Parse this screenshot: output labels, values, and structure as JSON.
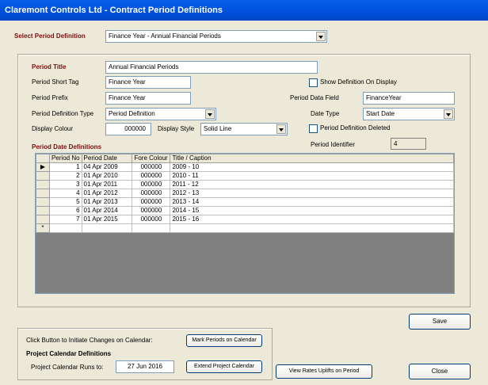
{
  "window": {
    "title": "Claremont Controls Ltd - Contract Period Definitions"
  },
  "select_period": {
    "label": "Select Period Definition",
    "value": "Finance Year - Annual Financial Periods"
  },
  "form": {
    "period_title_label": "Period Title",
    "period_title": "Annual Financial Periods",
    "short_tag_label": "Period Short Tag",
    "short_tag": "Finance Year",
    "prefix_label": "Period Prefix",
    "prefix": "Finance Year",
    "def_type_label": "Period Definition Type",
    "def_type": "Period Definition",
    "colour_label": "Display Colour",
    "colour": "000000",
    "style_label": "Display Style",
    "style": "Solid Line",
    "show_def_label": "Show Definition On Display",
    "data_field_label": "Period Data Field",
    "data_field": "FinanceYear",
    "date_type_label": "Date Type",
    "date_type": "Start Date",
    "deleted_label": "Period Definition Deleted",
    "identifier_label": "Period Identifier",
    "identifier": "4",
    "dates_heading": "Period Date Definitions"
  },
  "grid": {
    "columns": [
      "Period No",
      "Period Date",
      "Fore Colour",
      "Title / Caption"
    ],
    "rows": [
      {
        "no": "1",
        "date": "04 Apr 2009",
        "colour": "000000",
        "title": "2009 - 10"
      },
      {
        "no": "2",
        "date": "01 Apr 2010",
        "colour": "000000",
        "title": "2010 - 11"
      },
      {
        "no": "3",
        "date": "01 Apr 2011",
        "colour": "000000",
        "title": "2011 - 12"
      },
      {
        "no": "4",
        "date": "01 Apr 2012",
        "colour": "000000",
        "title": "2012 - 13"
      },
      {
        "no": "5",
        "date": "01 Apr 2013",
        "colour": "000000",
        "title": "2013 - 14"
      },
      {
        "no": "6",
        "date": "01 Apr 2014",
        "colour": "000000",
        "title": "2014 - 15"
      },
      {
        "no": "7",
        "date": "01 Apr 2015",
        "colour": "000000",
        "title": "2015 - 16"
      }
    ],
    "new_row_marker": "*",
    "current_marker": "▶"
  },
  "calendar": {
    "instruction": "Click Button to Initiate Changes on Calendar:",
    "mark_button": "Mark Periods on Calendar",
    "heading": "Project Calendar Definitions",
    "runs_to_label": "Project Calendar Runs to:",
    "runs_to": "27 Jun 2016",
    "extend_button": "Extend Project Calendar"
  },
  "buttons": {
    "save": "Save",
    "view_rates": "View Rates Uplifts on Period",
    "close": "Close"
  }
}
